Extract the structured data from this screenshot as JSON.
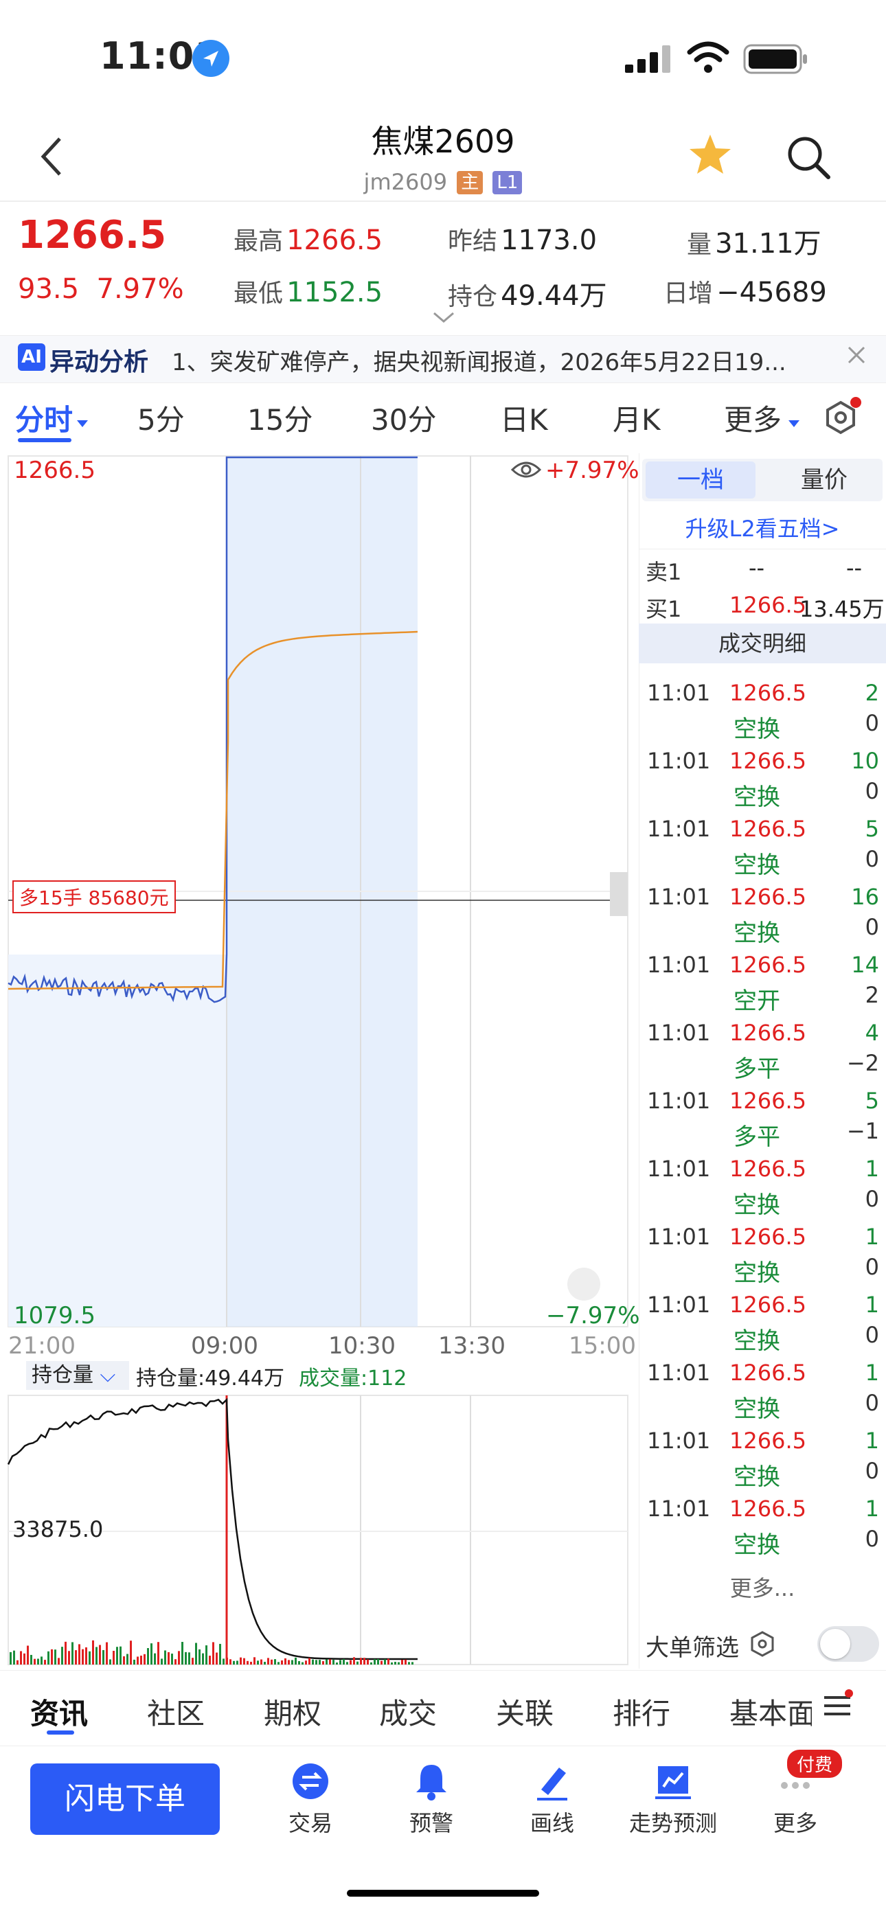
{
  "status": {
    "time": "11:01"
  },
  "header": {
    "title": "焦煤2609",
    "code": "jm2609",
    "tag_main": "主",
    "tag_l1": "L1"
  },
  "quote": {
    "price": "1266.5",
    "change": "93.5",
    "change_pct": "7.97%",
    "high_label": "最高",
    "high": "1266.5",
    "low_label": "最低",
    "low": "1152.5",
    "prev_settle_label": "昨结",
    "prev_settle": "1173.0",
    "oi_label": "持仓",
    "oi": "49.44万",
    "volume_label": "量",
    "volume": "31.11万",
    "daily_inc_label": "日增",
    "daily_inc": "−45689"
  },
  "ai": {
    "badge": "AI",
    "title": "异动分析",
    "text": "1、突发矿难停产，据央视新闻报道，2026年5月22日19..."
  },
  "period_tabs": [
    "分时",
    "5分",
    "15分",
    "30分",
    "日K",
    "月K",
    "更多"
  ],
  "chart": {
    "high_label": "1266.5",
    "low_label": "1079.5",
    "pct_top": "+7.97%",
    "pct_bottom": "−7.97%",
    "prev_close_marker": "多15手 85680元",
    "x_ticks": [
      "21:00",
      "09:00",
      "10:30",
      "13:30",
      "15:00"
    ],
    "vol_dropdown": "持仓量",
    "vol_oi_text": "持仓量:49.44万",
    "vol_vol_text": "成交量:112",
    "vol_ylabel": "33875.0",
    "colors": {
      "price_line": "#3b5cc7",
      "avg_line": "#e8912a",
      "fill": "#dce8fb"
    }
  },
  "right_panel": {
    "tab_1": "一档",
    "tab_2": "量价",
    "upgrade": "升级L2看五档>",
    "sell1_label": "卖1",
    "sell1_price": "--",
    "sell1_qty": "--",
    "buy1_label": "买1",
    "buy1_price": "1266.5",
    "buy1_qty": "13.45万",
    "detail_header": "成交明细",
    "trades": [
      {
        "time": "11:01",
        "price": "1266.5",
        "qty": "2",
        "type": "空换",
        "oi": "0"
      },
      {
        "time": "11:01",
        "price": "1266.5",
        "qty": "10",
        "type": "空换",
        "oi": "0"
      },
      {
        "time": "11:01",
        "price": "1266.5",
        "qty": "5",
        "type": "空换",
        "oi": "0"
      },
      {
        "time": "11:01",
        "price": "1266.5",
        "qty": "16",
        "type": "空换",
        "oi": "0"
      },
      {
        "time": "11:01",
        "price": "1266.5",
        "qty": "14",
        "type": "空开",
        "oi": "2"
      },
      {
        "time": "11:01",
        "price": "1266.5",
        "qty": "4",
        "type": "多平",
        "oi": "−2"
      },
      {
        "time": "11:01",
        "price": "1266.5",
        "qty": "5",
        "type": "多平",
        "oi": "−1"
      },
      {
        "time": "11:01",
        "price": "1266.5",
        "qty": "1",
        "type": "空换",
        "oi": "0"
      },
      {
        "time": "11:01",
        "price": "1266.5",
        "qty": "1",
        "type": "空换",
        "oi": "0"
      },
      {
        "time": "11:01",
        "price": "1266.5",
        "qty": "1",
        "type": "空换",
        "oi": "0"
      },
      {
        "time": "11:01",
        "price": "1266.5",
        "qty": "1",
        "type": "空换",
        "oi": "0"
      },
      {
        "time": "11:01",
        "price": "1266.5",
        "qty": "1",
        "type": "空换",
        "oi": "0"
      },
      {
        "time": "11:01",
        "price": "1266.5",
        "qty": "1",
        "type": "空换",
        "oi": "0"
      }
    ],
    "more": "更多...",
    "filter_label": "大单筛选"
  },
  "bottom_tabs": [
    "资讯",
    "社区",
    "期权",
    "成交",
    "关联",
    "排行",
    "基本面"
  ],
  "actions": {
    "flash_order": "闪电下单",
    "trade": "交易",
    "alert": "预警",
    "draw": "画线",
    "trend": "走势预测",
    "more": "更多",
    "paid_badge": "付费"
  }
}
